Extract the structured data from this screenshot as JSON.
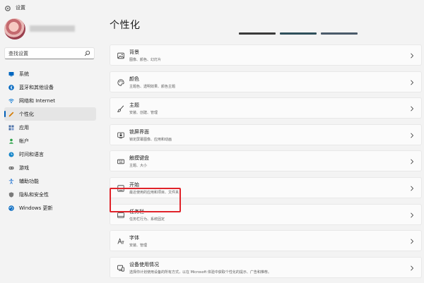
{
  "window": {
    "title": "设置"
  },
  "profile": {
    "avatar": "avatar-image"
  },
  "search": {
    "placeholder": "查找设置",
    "icon": "search-icon"
  },
  "nav": {
    "items": [
      {
        "label": "系统",
        "icon": "monitor-icon",
        "color": "#0067c0"
      },
      {
        "label": "蓝牙和其他设备",
        "icon": "bluetooth-icon",
        "color": "#0067c0"
      },
      {
        "label": "网络和 Internet",
        "icon": "wifi-icon",
        "color": "#0a78d4"
      },
      {
        "label": "个性化",
        "icon": "pen-icon",
        "color": "#d47a00",
        "active": true
      },
      {
        "label": "应用",
        "icon": "apps-icon",
        "color": "#4a6fa5"
      },
      {
        "label": "帐户",
        "icon": "person-icon",
        "color": "#2aa147"
      },
      {
        "label": "时间和语言",
        "icon": "globe-clock-icon",
        "color": "#1585c9"
      },
      {
        "label": "游戏",
        "icon": "gamepad-icon",
        "color": "#6b6b6b"
      },
      {
        "label": "辅助功能",
        "icon": "accessibility-icon",
        "color": "#2b7bd4"
      },
      {
        "label": "隐私和安全性",
        "icon": "shield-icon",
        "color": "#7a7a7a"
      },
      {
        "label": "Windows 更新",
        "icon": "update-icon",
        "color": "#0067c0"
      }
    ]
  },
  "main": {
    "title": "个性化",
    "cards": [
      {
        "label": "背景",
        "desc": "图像、颜色、幻灯片",
        "icon": "image-icon"
      },
      {
        "label": "颜色",
        "desc": "主题色、透明效果、颜色主题",
        "icon": "palette-icon"
      },
      {
        "label": "主题",
        "desc": "安装、创建、管理",
        "icon": "brush-icon"
      },
      {
        "label": "锁屏界面",
        "desc": "锁定屏幕图像、应用和动画",
        "icon": "lock-screen-icon"
      },
      {
        "label": "触摸键盘",
        "desc": "主题、大小",
        "icon": "keyboard-icon"
      },
      {
        "label": "开始",
        "desc": "最近使用的应用和项目、文件夹",
        "icon": "start-icon"
      },
      {
        "label": "任务栏",
        "desc": "任务栏行为、系统固定",
        "icon": "taskbar-icon"
      },
      {
        "label": "字体",
        "desc": "安装、管理",
        "icon": "font-icon"
      },
      {
        "label": "设备使用情况",
        "desc": "选择你计划使用设备的所有方式，以在 Microsoft 体验中获取个性化的提示、广告和推荐。",
        "icon": "device-usage-icon"
      }
    ]
  },
  "theme_colors": [
    "#3a3a3a",
    "#2f4f5a",
    "#4a5a6a"
  ]
}
